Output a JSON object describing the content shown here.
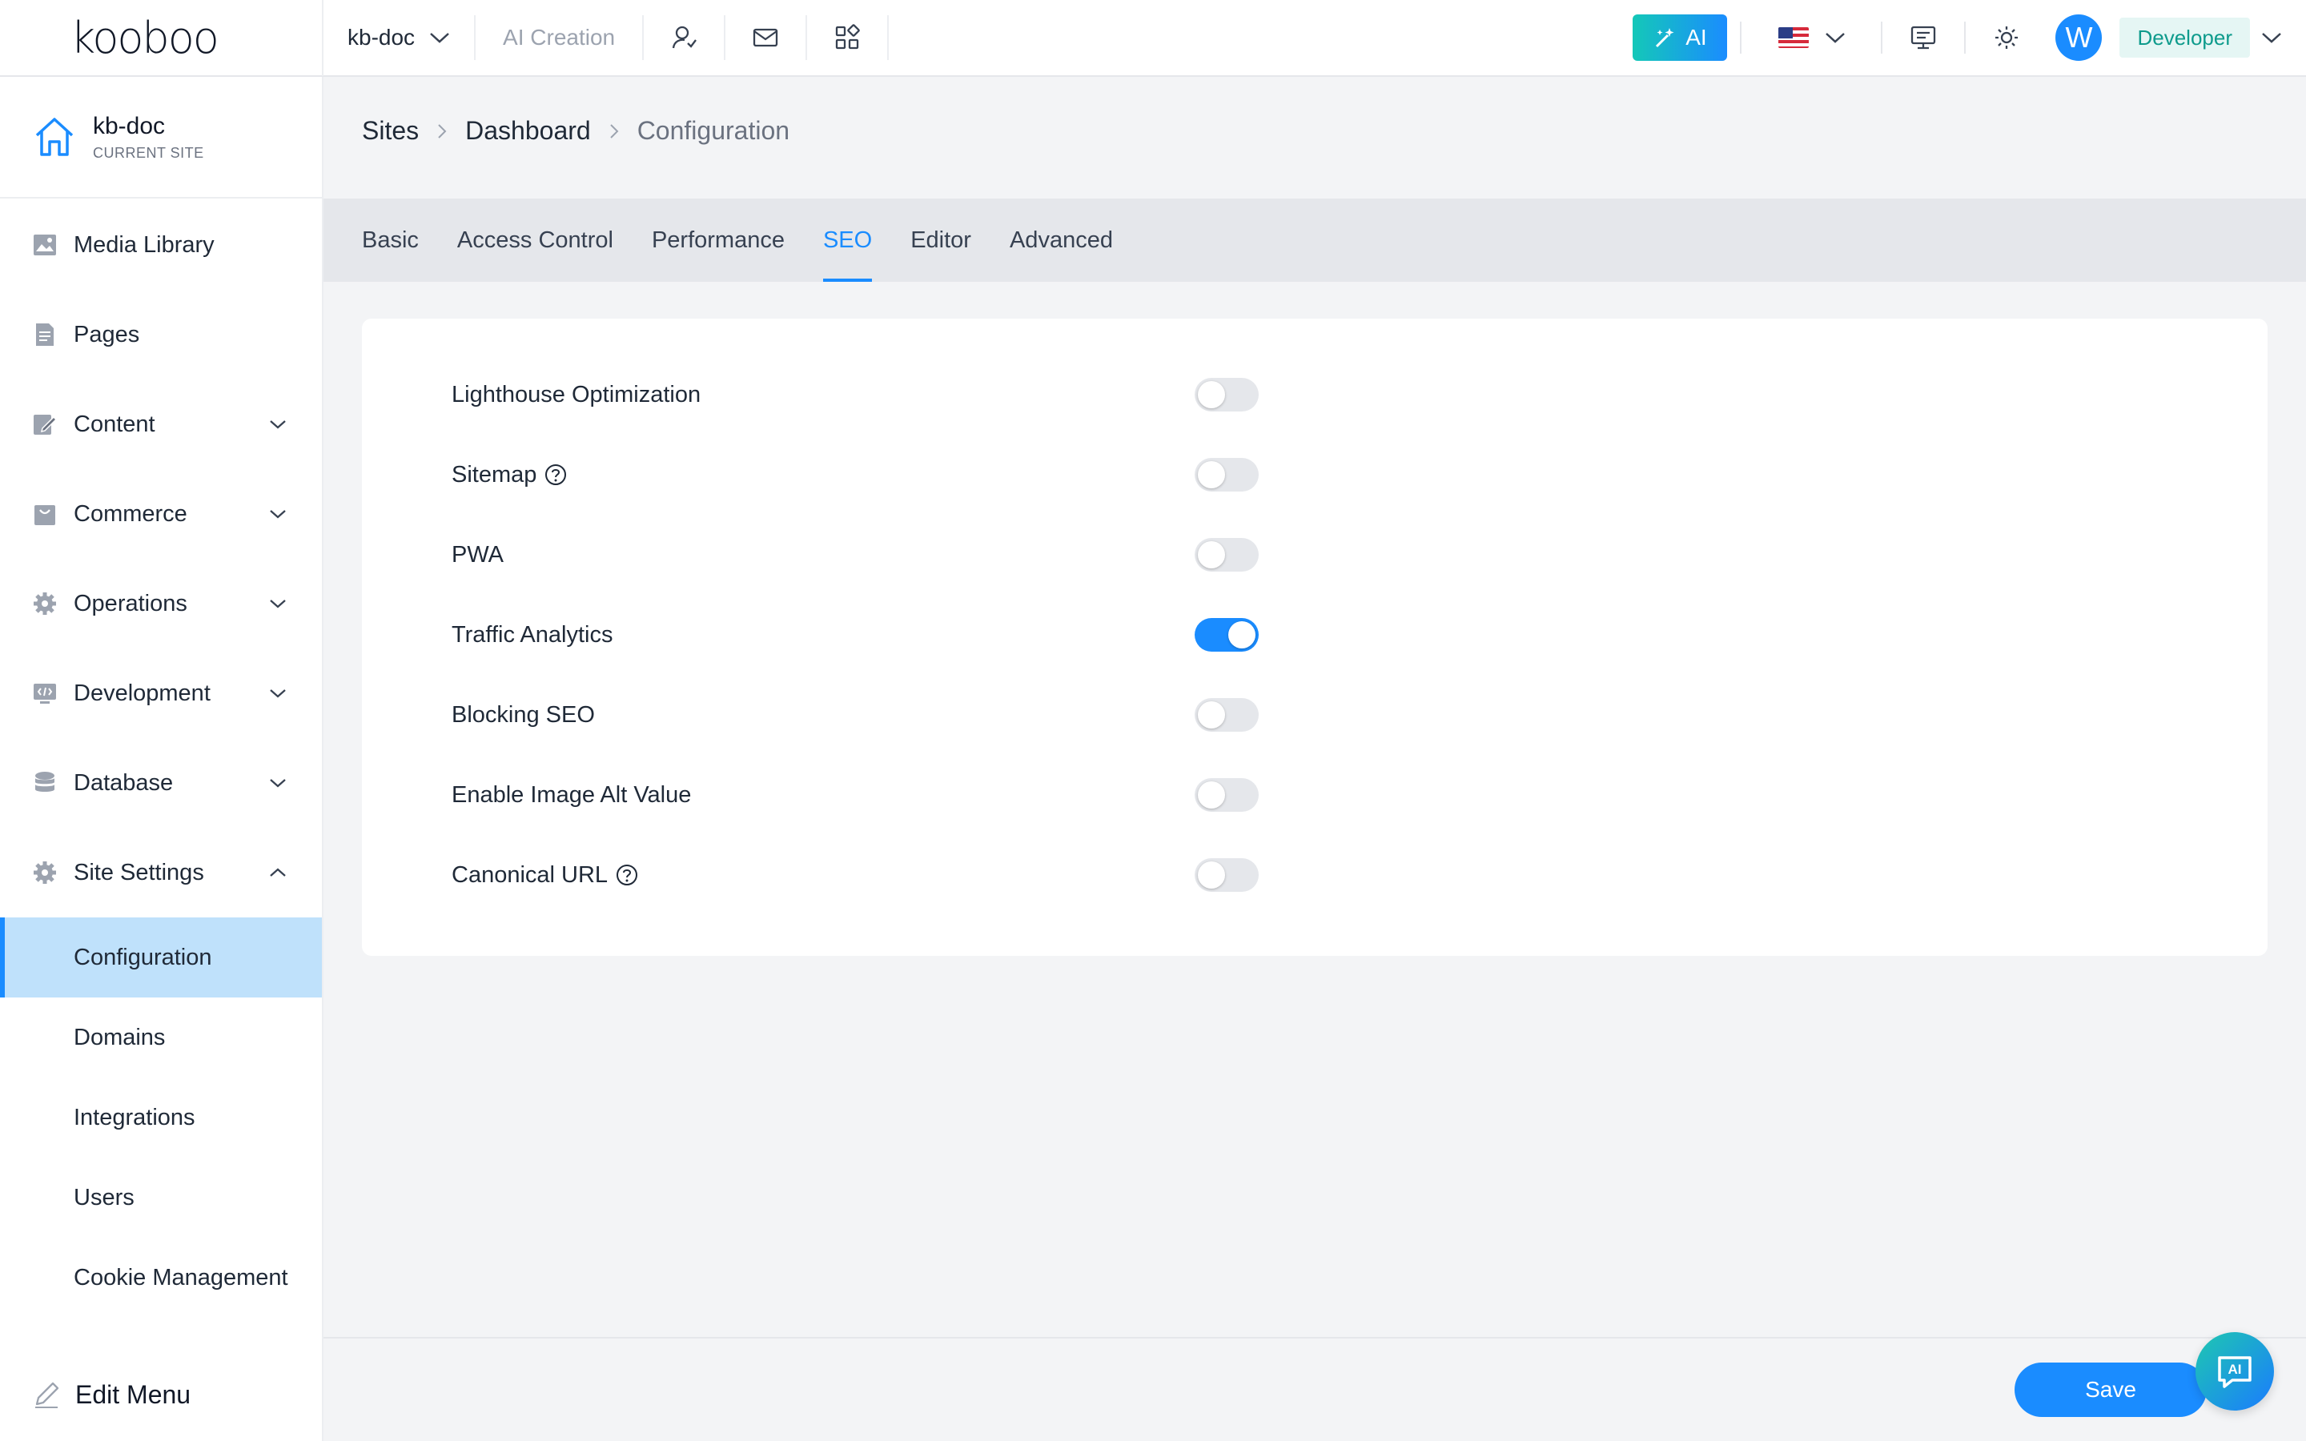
{
  "topbar": {
    "logo": "kooboo",
    "site_name": "kb-doc",
    "ai_creation": "AI Creation",
    "ai_button": "AI",
    "avatar_letter": "W",
    "role": "Developer"
  },
  "sidebar": {
    "current_site": {
      "name": "kb-doc",
      "caption": "CURRENT SITE"
    },
    "items": [
      {
        "label": "Media Library",
        "icon": "image-icon"
      },
      {
        "label": "Pages",
        "icon": "document-icon"
      },
      {
        "label": "Content",
        "icon": "edit-icon"
      },
      {
        "label": "Commerce",
        "icon": "bag-icon"
      },
      {
        "label": "Operations",
        "icon": "gear-icon"
      },
      {
        "label": "Development",
        "icon": "code-icon"
      },
      {
        "label": "Database",
        "icon": "database-icon"
      },
      {
        "label": "Site Settings",
        "icon": "gear-icon"
      }
    ],
    "sub_items": [
      {
        "label": "Configuration"
      },
      {
        "label": "Domains"
      },
      {
        "label": "Integrations"
      },
      {
        "label": "Users"
      },
      {
        "label": "Cookie Management"
      }
    ],
    "edit_menu": "Edit Menu"
  },
  "breadcrumb": {
    "sites": "Sites",
    "dashboard": "Dashboard",
    "current": "Configuration"
  },
  "tabs": [
    {
      "label": "Basic"
    },
    {
      "label": "Access Control"
    },
    {
      "label": "Performance"
    },
    {
      "label": "SEO"
    },
    {
      "label": "Editor"
    },
    {
      "label": "Advanced"
    }
  ],
  "active_tab": "SEO",
  "settings": [
    {
      "label": "Lighthouse Optimization",
      "enabled": false
    },
    {
      "label": "Sitemap",
      "enabled": false,
      "help": true
    },
    {
      "label": "PWA",
      "enabled": false
    },
    {
      "label": "Traffic Analytics",
      "enabled": true
    },
    {
      "label": "Blocking SEO",
      "enabled": false
    },
    {
      "label": "Enable Image Alt Value",
      "enabled": false
    },
    {
      "label": "Canonical URL",
      "enabled": false,
      "help": true
    }
  ],
  "footer": {
    "save_label": "Save",
    "ai_fab_label": "AI"
  },
  "colors": {
    "accent": "#1a8cff",
    "active_bg": "#bfe1fb",
    "role_text": "#0e9b8c"
  }
}
